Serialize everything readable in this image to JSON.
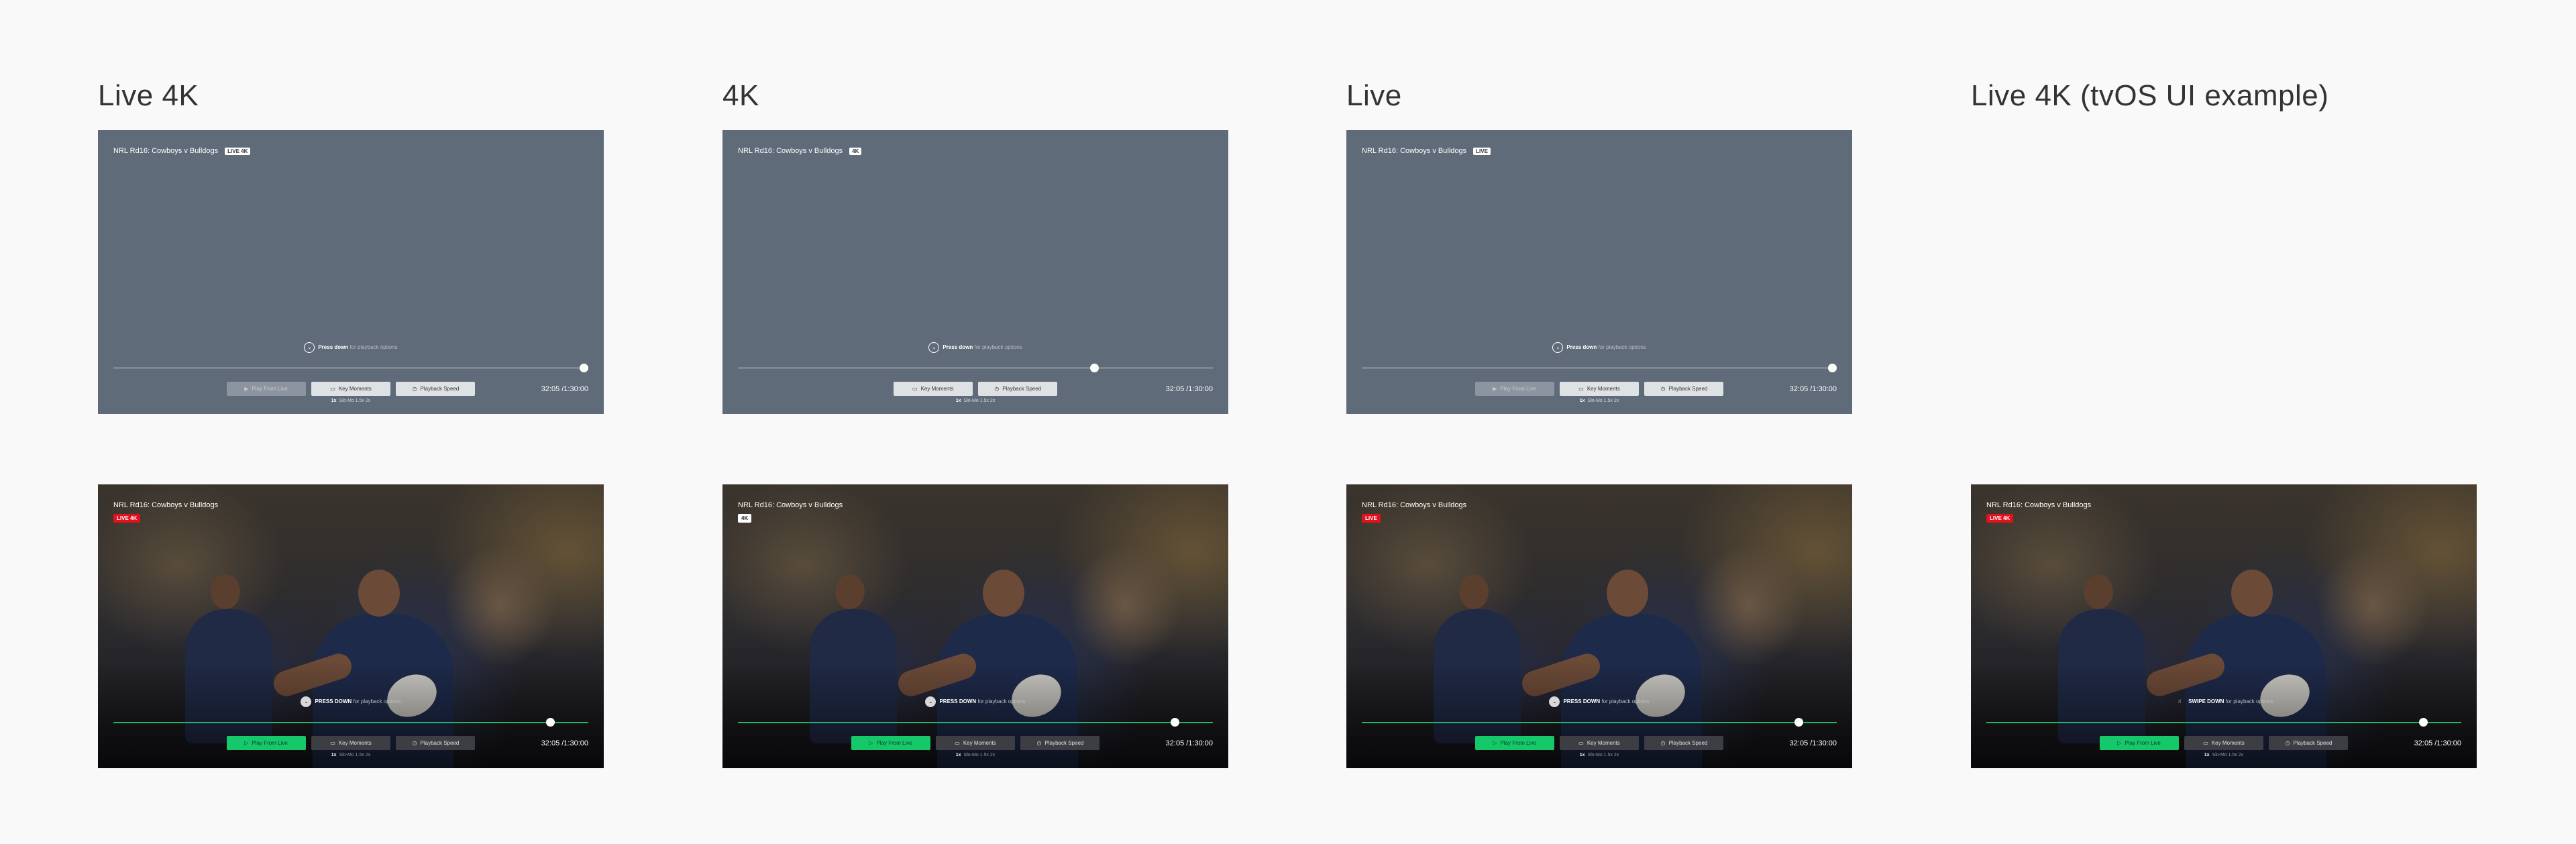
{
  "columns": [
    {
      "title": "Live 4K",
      "badge_inline": "LIVE 4K",
      "badge_block": "LIVE 4K",
      "badge_block_color": "#e3101d",
      "has_play_from_live": true,
      "progress": 0.99,
      "photo_progress": 0.92,
      "hint_label": "PRESS DOWN"
    },
    {
      "title": "4K",
      "badge_inline": "4K",
      "badge_block": "4K",
      "badge_block_color": "#ffffff",
      "has_play_from_live": false,
      "progress": 0.75,
      "photo_progress": 0.92,
      "hint_label": "PRESS DOWN"
    },
    {
      "title": "Live",
      "badge_inline": "LIVE",
      "badge_block": "LIVE",
      "badge_block_color": "#e3101d",
      "has_play_from_live": true,
      "progress": 0.99,
      "photo_progress": 0.92,
      "hint_label": "PRESS DOWN"
    },
    {
      "title": "Live 4K (tvOS UI example)",
      "badge_block": "LIVE 4K",
      "badge_block_color": "#e3101d",
      "has_play_from_live": true,
      "photo_progress": 0.92,
      "hint_label": "SWIPE DOWN"
    }
  ],
  "match_title": "NRL Rd16: Cowboys v Bulldogs",
  "wire_hint": {
    "strong": "Press down",
    "rest": "for playback options"
  },
  "photo_hint_rest": "for playback options",
  "buttons": {
    "play_from_live": "Play From Live",
    "key_moments": "Key Moments",
    "playback_speed": "Playback Speed"
  },
  "time": "32:05 /1:30:00",
  "speeds": {
    "current": "1x",
    "others": "Slo-Mo  1.5x  2x"
  },
  "colors": {
    "wireframe_bg": "#5f6b78",
    "accent_green": "#15c96a",
    "live_red": "#e3101d"
  }
}
